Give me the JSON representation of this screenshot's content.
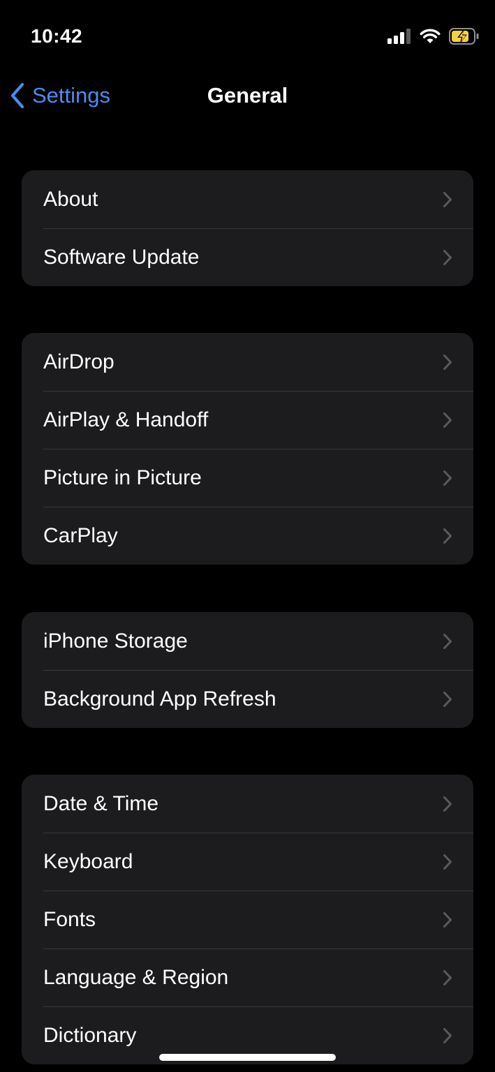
{
  "status_bar": {
    "time": "10:42",
    "icons": [
      "cellular-signal-icon",
      "wifi-icon",
      "battery-charging-icon"
    ]
  },
  "nav": {
    "back_label": "Settings",
    "title": "General"
  },
  "groups": [
    {
      "items": [
        {
          "label": "About"
        },
        {
          "label": "Software Update"
        }
      ]
    },
    {
      "items": [
        {
          "label": "AirDrop"
        },
        {
          "label": "AirPlay & Handoff"
        },
        {
          "label": "Picture in Picture"
        },
        {
          "label": "CarPlay"
        }
      ]
    },
    {
      "items": [
        {
          "label": "iPhone Storage"
        },
        {
          "label": "Background App Refresh"
        }
      ]
    },
    {
      "items": [
        {
          "label": "Date & Time"
        },
        {
          "label": "Keyboard"
        },
        {
          "label": "Fonts"
        },
        {
          "label": "Language & Region"
        },
        {
          "label": "Dictionary"
        }
      ]
    }
  ],
  "colors": {
    "background": "#000000",
    "cell_background": "#1c1c1e",
    "separator": "#38383a",
    "accent": "#4a8cf0",
    "chevron": "#5a5a5e",
    "battery_charging": "#f5d142"
  }
}
